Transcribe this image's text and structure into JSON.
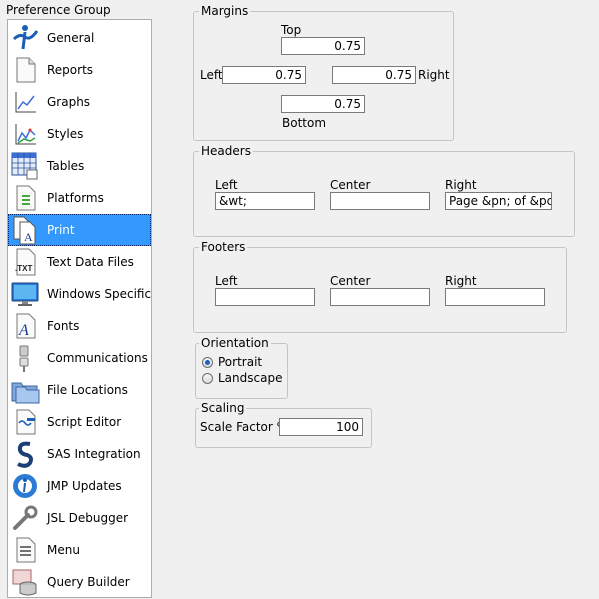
{
  "preference_group": {
    "title": "Preference Group",
    "items": [
      {
        "label": "General",
        "icon": "jmp-logo-icon"
      },
      {
        "label": "Reports",
        "icon": "report-page-icon"
      },
      {
        "label": "Graphs",
        "icon": "line-graph-icon"
      },
      {
        "label": "Styles",
        "icon": "styled-chart-icon"
      },
      {
        "label": "Tables",
        "icon": "table-grid-icon"
      },
      {
        "label": "Platforms",
        "icon": "platform-page-icon"
      },
      {
        "label": "Print",
        "icon": "print-document-icon",
        "selected": true
      },
      {
        "label": "Text Data Files",
        "icon": "txt-file-icon"
      },
      {
        "label": "Windows Specific",
        "icon": "monitor-icon"
      },
      {
        "label": "Fonts",
        "icon": "font-letter-icon"
      },
      {
        "label": "Communications",
        "icon": "plug-icon"
      },
      {
        "label": "File Locations",
        "icon": "folder-icon"
      },
      {
        "label": "Script Editor",
        "icon": "script-editor-icon"
      },
      {
        "label": "SAS Integration",
        "icon": "sas-logo-icon"
      },
      {
        "label": "JMP Updates",
        "icon": "update-arrows-icon"
      },
      {
        "label": "JSL Debugger",
        "icon": "wrench-icon"
      },
      {
        "label": "Menu",
        "icon": "menu-list-icon"
      },
      {
        "label": "Query Builder",
        "icon": "database-query-icon"
      }
    ]
  },
  "margins": {
    "title": "Margins",
    "top_label": "Top",
    "top_value": "0.75",
    "left_label": "Left",
    "left_value": "0.75",
    "right_label": "Right",
    "right_value": "0.75",
    "bottom_label": "Bottom",
    "bottom_value": "0.75"
  },
  "headers": {
    "title": "Headers",
    "left_label": "Left",
    "left_value": "&wt;",
    "center_label": "Center",
    "center_value": "",
    "right_label": "Right",
    "right_value": "Page &pn; of &pc;"
  },
  "footers": {
    "title": "Footers",
    "left_label": "Left",
    "left_value": "",
    "center_label": "Center",
    "center_value": "",
    "right_label": "Right",
    "right_value": ""
  },
  "orientation": {
    "title": "Orientation",
    "options": [
      "Portrait",
      "Landscape"
    ],
    "selected": "Portrait"
  },
  "scaling": {
    "title": "Scaling",
    "scale_label": "Scale Factor %",
    "scale_value": "100"
  },
  "colors": {
    "selection": "#3399ff",
    "panel_bg": "#f0f0f0",
    "group_border": "#c5c5c5"
  }
}
